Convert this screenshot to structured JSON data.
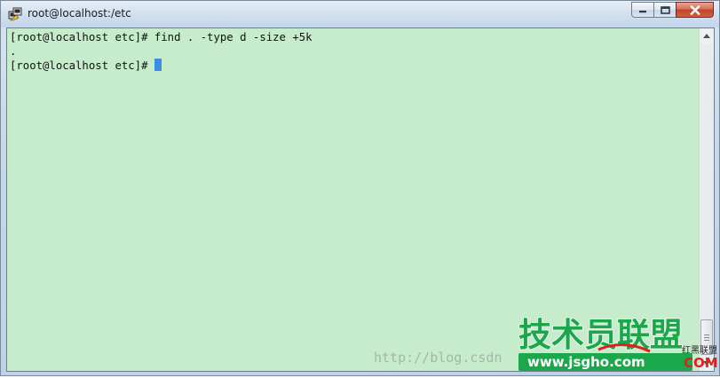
{
  "window": {
    "title": "root@localhost:/etc"
  },
  "caption_buttons": {
    "minimize_icon": "minimize-icon",
    "maximize_icon": "maximize-icon",
    "close_icon": "close-icon"
  },
  "terminal": {
    "lines": [
      "[root@localhost etc]# find . -type d -size +5k",
      ".",
      "[root@localhost etc]#"
    ],
    "background": "#c7eccc",
    "cursor_color": "#3b8fe0"
  },
  "watermark": {
    "url_text": "http://blog.csdn",
    "logo_cn": "技术员联盟",
    "logo_small_cn": "红黑联盟",
    "logo_site": "www.jsgho.com",
    "logo_com": "COM"
  },
  "colors": {
    "logo_green": "#1aa84a",
    "logo_red": "#e0201c"
  }
}
